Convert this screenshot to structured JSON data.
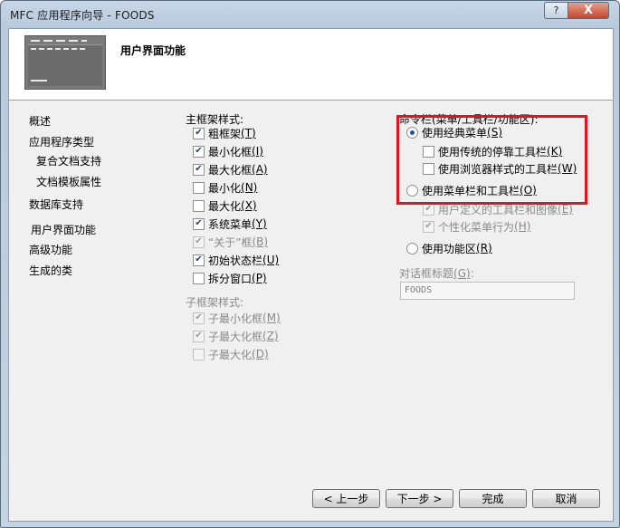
{
  "window": {
    "title": "MFC 应用程序向导 - FOODS",
    "help_label": "?",
    "close_label": "X"
  },
  "header": {
    "title": "用户界面功能"
  },
  "nav": {
    "items": [
      {
        "label": "概述"
      },
      {
        "label": "应用程序类型"
      },
      {
        "label": "复合文档支持"
      },
      {
        "label": "文档模板属性"
      },
      {
        "label": "数据库支持"
      },
      {
        "label": "用户界面功能"
      },
      {
        "label": "高级功能"
      },
      {
        "label": "生成的类"
      }
    ]
  },
  "main_frame": {
    "label": "主框架样式:",
    "options": [
      {
        "label": "粗框架",
        "key": "(T)",
        "checked": true
      },
      {
        "label": "最小化框",
        "key": "(I)",
        "checked": true
      },
      {
        "label": "最大化框",
        "key": "(A)",
        "checked": true
      },
      {
        "label": "最小化",
        "key": "(N)",
        "checked": false
      },
      {
        "label": "最大化",
        "key": "(X)",
        "checked": false
      },
      {
        "label": "系统菜单",
        "key": "(Y)",
        "checked": true
      },
      {
        "label": "“关于”框",
        "key": "(B)",
        "checked": true,
        "disabled": true
      },
      {
        "label": "初始状态栏",
        "key": "(U)",
        "checked": true
      },
      {
        "label": "拆分窗口",
        "key": "(P)",
        "checked": false
      }
    ]
  },
  "child_frame": {
    "label": "子框架样式:",
    "options": [
      {
        "label": "子最小化框",
        "key": "(M)",
        "checked": true
      },
      {
        "label": "子最大化框",
        "key": "(Z)",
        "checked": true
      },
      {
        "label": "子最大化",
        "key": "(D)",
        "checked": false
      }
    ]
  },
  "command_bar": {
    "label": "命令栏(菜单/工具栏/功能区):",
    "classic_menu": {
      "label": "使用经典菜单",
      "key": "(S)",
      "selected": true
    },
    "docking_toolbar": {
      "label": "使用传统的停靠工具栏",
      "key": "(K)",
      "checked": false
    },
    "browser_toolbar": {
      "label": "使用浏览器样式的工具栏",
      "key": "(W)",
      "checked": false
    },
    "menubar_toolbar": {
      "label": "使用菜单栏和工具栏",
      "key": "(O)",
      "selected": false
    },
    "user_defined": {
      "label": "用户定义的工具栏和图像",
      "key": "(E)",
      "checked": true
    },
    "personalized": {
      "label": "个性化菜单行为",
      "key": "(H)",
      "checked": true
    },
    "ribbon": {
      "label": "使用功能区",
      "key": "(R)",
      "selected": false
    }
  },
  "dialog_title": {
    "label": "对话框标题",
    "key": "(G)",
    "suffix": ":",
    "value": "FOODS"
  },
  "buttons": {
    "prev": "< 上一步",
    "next": "下一步 >",
    "finish": "完成",
    "cancel": "取消"
  },
  "colors": {
    "highlight_border": "#e0141e",
    "radio_dot": "#1f4fa8"
  }
}
